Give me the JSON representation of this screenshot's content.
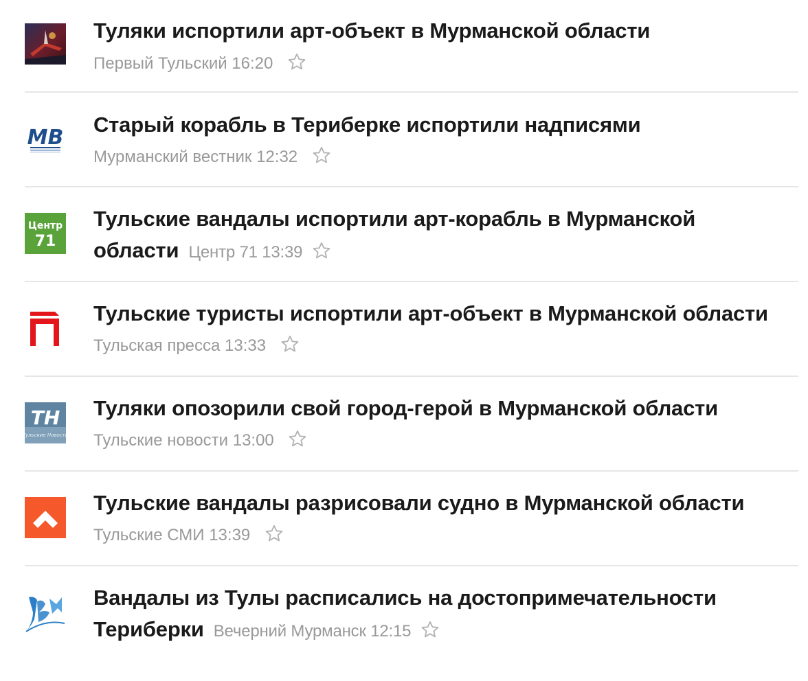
{
  "news": {
    "items": [
      {
        "headline": "Туляки испортили арт-объект в Мурманской области",
        "source": "Первый Тульский",
        "time": "16:20",
        "logo": "pervyi-tulskiy-logo-icon",
        "star": "star-icon"
      },
      {
        "headline": "Старый корабль в Териберке испортили надписями",
        "source": "Мурманский вестник",
        "time": "12:32",
        "logo": "murmanskiy-vestnik-logo-icon",
        "logo_text": "МВ",
        "star": "star-icon"
      },
      {
        "headline": "Тульские вандалы испортили арт-корабль в Мурманской области",
        "source": "Центр 71",
        "time": "13:39",
        "logo": "centr71-logo-icon",
        "logo_text_top": "Центр",
        "logo_text_bottom": "71",
        "star": "star-icon"
      },
      {
        "headline": "Тульские туристы испортили арт-объект в Мурманской области",
        "source": "Тульская пресса",
        "time": "13:33",
        "logo": "tulskaya-pressa-logo-icon",
        "star": "star-icon"
      },
      {
        "headline": "Туляки опозорили свой город-герой в Мурманской области",
        "source": "Тульские новости",
        "time": "13:00",
        "logo": "tulskie-novosti-logo-icon",
        "logo_text": "TH",
        "logo_subtext": "Тульские Новости",
        "star": "star-icon"
      },
      {
        "headline": "Тульские вандалы разрисовали судно в Мурманской области",
        "source": "Тульские СМИ",
        "time": "13:39",
        "logo": "tulskie-smi-logo-icon",
        "star": "star-icon"
      },
      {
        "headline": "Вандалы из Тулы расписались на достопримечательности Териберки",
        "source": "Вечерний Мурманск",
        "time": "12:15",
        "logo": "vecherniy-murmansk-logo-icon",
        "star": "star-icon"
      }
    ]
  },
  "colors": {
    "headline": "#1a1a1a",
    "meta": "#999999",
    "separator": "#e6e6e6",
    "star": "#b3b3b3",
    "centr71_green": "#5aa33a",
    "tulskaya_pressa_red": "#e3161b",
    "tulskie_smi_orange": "#f4582b",
    "murmanskiy_vestnik_blue": "#1f4e8c",
    "tulskie_novosti_bg": "#7fa0b8",
    "vecherniy_murmansk_blue": "#2b7fc8"
  }
}
